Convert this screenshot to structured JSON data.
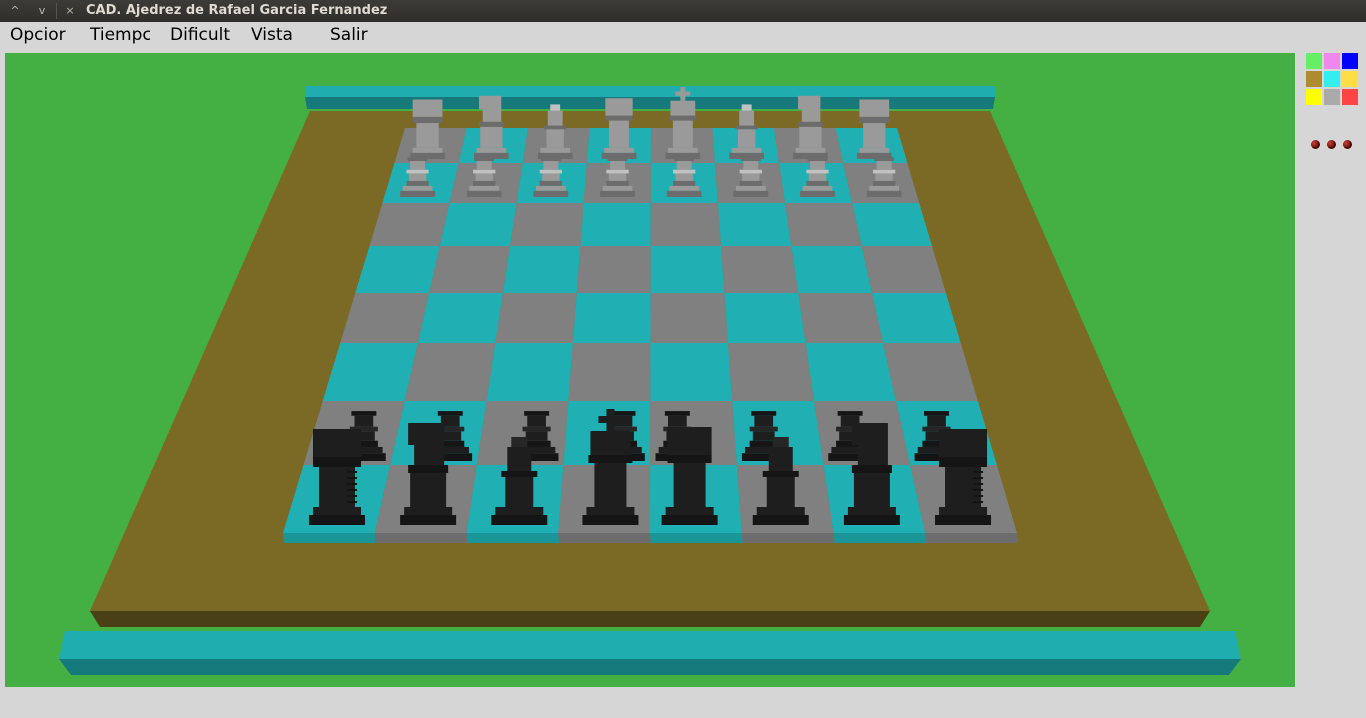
{
  "window": {
    "title": "CAD. Ajedrez de Rafael Garcia Fernandez",
    "controls": [
      "^",
      "v",
      "×"
    ]
  },
  "menu": {
    "items": [
      "Opcior",
      "Tiempc",
      "Dificult",
      "Vista",
      "Salir"
    ]
  },
  "scene": {
    "background_color": "#44b044",
    "base_color": "#7a6a25",
    "rim_color": "#1fadb0",
    "light_square_color": "#20b0b3",
    "dark_square_color": "#808080",
    "white_piece_color": "#9a9a9a",
    "black_piece_color": "#1e1e1e",
    "white_back_rank": [
      "rook",
      "knight",
      "bishop",
      "queen",
      "king",
      "bishop",
      "knight",
      "rook"
    ],
    "white_pawn_rank": [
      "pawn",
      "pawn",
      "pawn",
      "pawn",
      "pawn",
      "pawn",
      "pawn",
      "pawn"
    ],
    "black_pawn_rank": [
      "pawn",
      "pawn",
      "pawn",
      "pawn",
      "pawn",
      "pawn",
      "pawn",
      "pawn"
    ],
    "black_back_rank": [
      "rook",
      "knight",
      "bishop",
      "king",
      "queen",
      "bishop",
      "knight",
      "rook"
    ]
  },
  "palette": {
    "swatches": [
      "#66ee66",
      "#ee88ee",
      "#0000ff",
      "#b08a30",
      "#33eeee",
      "#ffdd44",
      "#ffff00",
      "#aaaaaa",
      "#ff4444"
    ]
  },
  "indicators": {
    "dots": 3
  }
}
